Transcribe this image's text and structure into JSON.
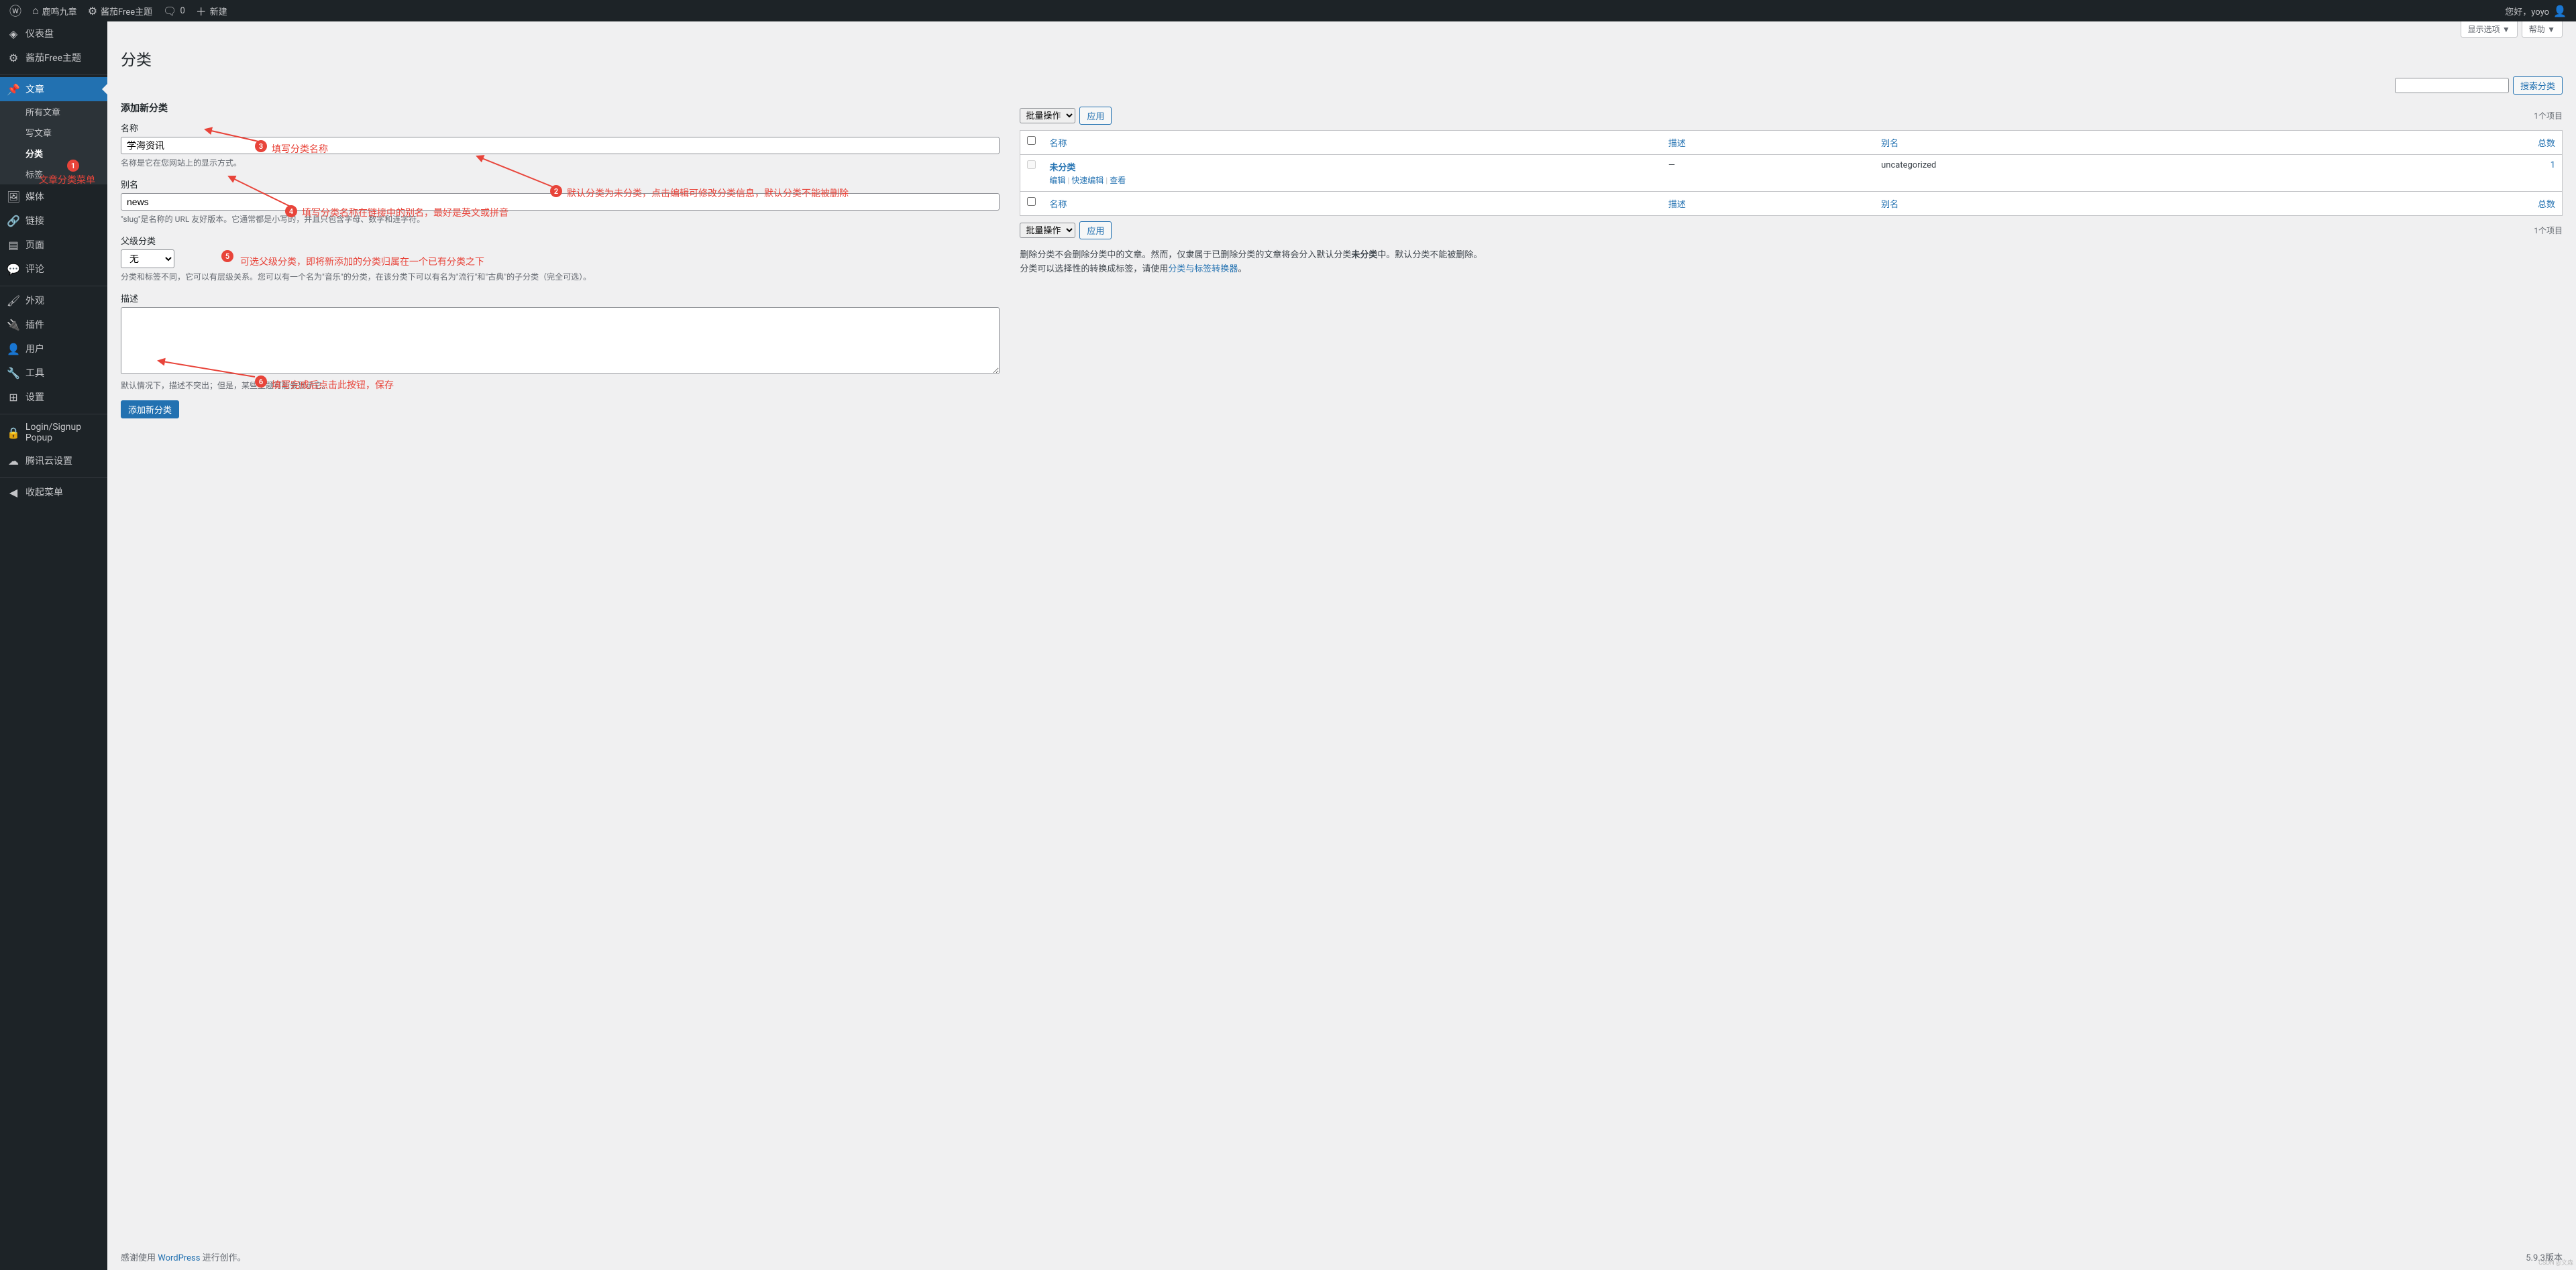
{
  "adminbar": {
    "site_name": "鹿鸣九章",
    "theme_link": "酱茄Free主题",
    "comments": "0",
    "new": "新建",
    "greeting": "您好，yoyo"
  },
  "sidebar": {
    "items": [
      {
        "icon": "◈",
        "label": "仪表盘"
      },
      {
        "icon": "⚙",
        "label": "酱茄Free主题"
      },
      {
        "icon": "📌",
        "label": "文章",
        "current": true
      },
      {
        "icon": "🖼",
        "label": "媒体"
      },
      {
        "icon": "🔗",
        "label": "链接"
      },
      {
        "icon": "▤",
        "label": "页面"
      },
      {
        "icon": "💬",
        "label": "评论"
      },
      {
        "icon": "🖌",
        "label": "外观"
      },
      {
        "icon": "🔌",
        "label": "插件"
      },
      {
        "icon": "👤",
        "label": "用户"
      },
      {
        "icon": "🔧",
        "label": "工具"
      },
      {
        "icon": "⊞",
        "label": "设置"
      },
      {
        "icon": "🔒",
        "label": "Login/Signup Popup"
      },
      {
        "icon": "☁",
        "label": "腾讯云设置"
      },
      {
        "icon": "◀",
        "label": "收起菜单"
      }
    ],
    "submenu": [
      {
        "label": "所有文章"
      },
      {
        "label": "写文章"
      },
      {
        "label": "分类",
        "current": true
      },
      {
        "label": "标签"
      }
    ]
  },
  "page": {
    "screen_options": "显示选项 ▼",
    "help": "帮助 ▼",
    "title": "分类",
    "search_btn": "搜索分类",
    "add_heading": "添加新分类",
    "name_label": "名称",
    "name_value": "学海资讯",
    "name_desc": "名称是它在您网站上的显示方式。",
    "slug_label": "别名",
    "slug_value": "news",
    "slug_desc": "\"slug\"是名称的 URL 友好版本。它通常都是小写的，并且只包含字母、数字和连字符。",
    "parent_label": "父级分类",
    "parent_option": "无",
    "parent_desc": "分类和标签不同，它可以有层级关系。您可以有一个名为\"音乐\"的分类，在该分类下可以有名为\"流行\"和\"古典\"的子分类（完全可选）。",
    "desc_label": "描述",
    "desc_desc": "默认情况下，描述不突出；但是，某些主题可能会显示它。",
    "submit": "添加新分类",
    "bulk_label": "批量操作",
    "apply": "应用",
    "items_count": "1个项目",
    "col_name": "名称",
    "col_desc": "描述",
    "col_slug": "别名",
    "col_count": "总数",
    "row_name": "未分类",
    "row_desc": "—",
    "row_slug": "uncategorized",
    "row_count": "1",
    "row_edit": "编辑",
    "row_quick": "快速编辑",
    "row_view": "查看",
    "note1_a": "删除分类不会删除分类中的文章。然而，仅隶属于已删除分类的文章将会分入默认分类",
    "note1_b": "未分类",
    "note1_c": "中。默认分类不能被删除。",
    "note2_a": "分类可以选择性的转换成标签，请使用",
    "note2_link": "分类与标签转换器",
    "note2_b": "。"
  },
  "annotations": {
    "a1": "文章分类菜单",
    "a2": "默认分类为未分类，点击编辑可修改分类信息，默认分类不能被删除",
    "a3": "填写分类名称",
    "a4": "填写分类名称在链接中的别名，最好是英文或拼音",
    "a5": "可选父级分类，即将新添加的分类归属在一个已有分类之下",
    "a6": "填写完成后点击此按钮，保存"
  },
  "footer": {
    "thanks_a": "感谢使用",
    "thanks_link": "WordPress",
    "thanks_b": "进行创作。",
    "version": "5.9.3版本"
  }
}
